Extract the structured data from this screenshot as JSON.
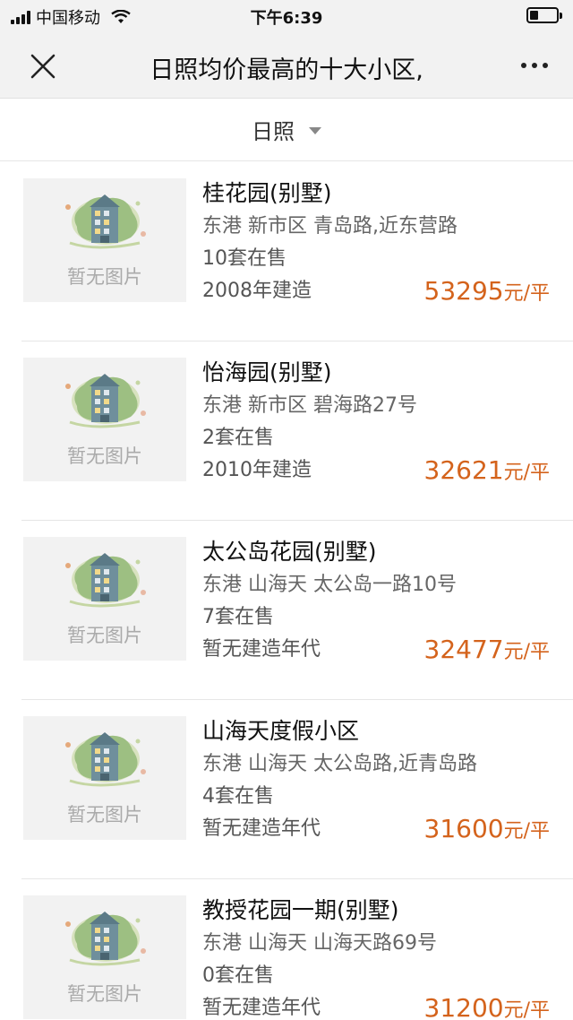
{
  "status": {
    "carrier": "中国移动",
    "time": "下午6:39"
  },
  "nav": {
    "title": "日照均价最高的十大小区,"
  },
  "filter": {
    "label": "日照"
  },
  "placeholder_text": "暂无图片",
  "items": [
    {
      "name": "桂花园(别墅)",
      "address": "东港 新市区 青岛路,近东营路",
      "sale": "10套在售",
      "built": "2008年建造",
      "price": "53295",
      "unit": "元/平"
    },
    {
      "name": "怡海园(别墅)",
      "address": "东港 新市区 碧海路27号",
      "sale": "2套在售",
      "built": "2010年建造",
      "price": "32621",
      "unit": "元/平"
    },
    {
      "name": "太公岛花园(别墅)",
      "address": "东港 山海天 太公岛一路10号",
      "sale": "7套在售",
      "built": "暂无建造年代",
      "price": "32477",
      "unit": "元/平"
    },
    {
      "name": "山海天度假小区",
      "address": "东港 山海天 太公岛路,近青岛路",
      "sale": "4套在售",
      "built": "暂无建造年代",
      "price": "31600",
      "unit": "元/平"
    },
    {
      "name": "教授花园一期(别墅)",
      "address": "东港 山海天 山海天路69号",
      "sale": "0套在售",
      "built": "暂无建造年代",
      "price": "31200",
      "unit": "元/平"
    }
  ],
  "colors": {
    "price": "#d4631c",
    "nav_bg": "#f2f2f2"
  }
}
